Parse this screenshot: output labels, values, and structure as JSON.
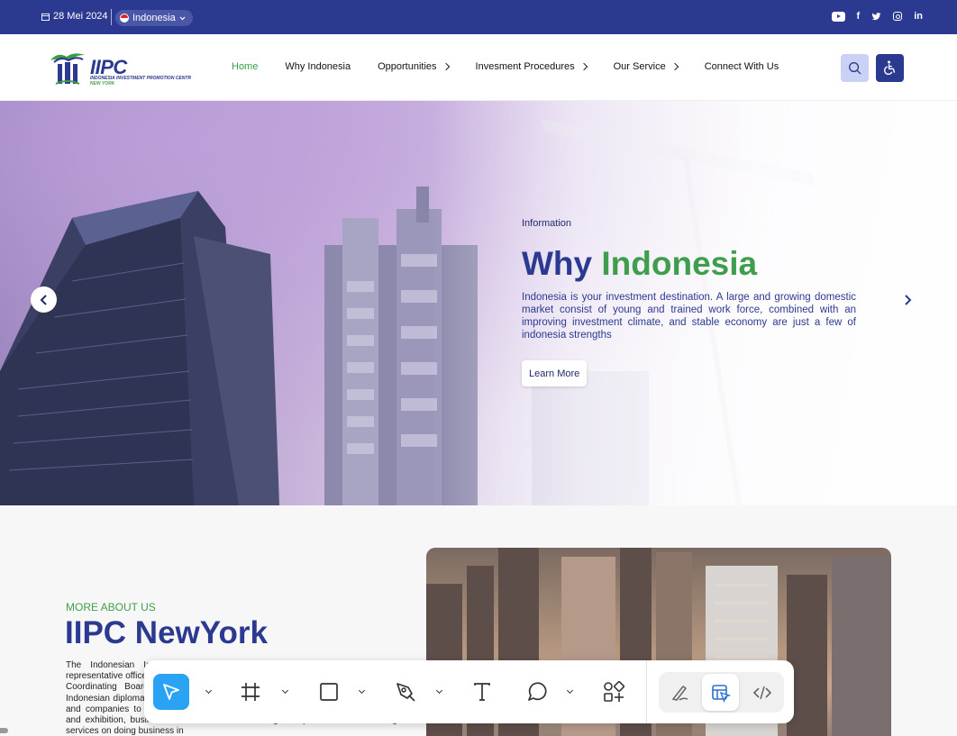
{
  "topbar": {
    "date": "28 Mei 2024",
    "language": "Indonesia",
    "socials": [
      "youtube-icon",
      "facebook-icon",
      "twitter-icon",
      "instagram-icon",
      "linkedin-icon"
    ]
  },
  "logo": {
    "text": "IIPC",
    "subtitle": "INDONESIA INVESTMENT PROMOTION CENTR",
    "location": "NEW YORK"
  },
  "nav": {
    "items": [
      {
        "label": "Home",
        "active": true
      },
      {
        "label": "Why Indonesia"
      },
      {
        "label": "Opportunities"
      },
      {
        "label": "Invesment Procedures"
      },
      {
        "label": "Our Service"
      },
      {
        "label": "Connect With Us"
      }
    ]
  },
  "hero": {
    "label": "Information",
    "title_main": "Why",
    "title_accent": "Indonesia",
    "description": "Indonesia is your investment destination. A large and growing domestic market consist of young and trained work force, combined with an improving investment climate, and stable economy are just a few of indonesia strengths",
    "button": "Learn More"
  },
  "about": {
    "subtitle": "MORE ABOUT US",
    "title": "IIPC NewYork",
    "text": "The Indonesian Investment Promotion Centre (IIPC) New York is the representative office of the Indonesia Ministry of Investment / Indonesia Investment Coordinating Board (BKPM). IIPC New York cooperates closely with the Indonesian diplomatic missions in the USA, as well as with business associations and companies to promote Indonesia's investment through investment seminar and exhibition, business mission and matchmaking. We provide free consulting services on doing business in",
    "image_logo": "IIPC"
  },
  "toolbar": {
    "tools": [
      "select-tool",
      "frame-tool",
      "rectangle-tool",
      "pen-tool",
      "text-tool",
      "comment-tool",
      "assets-tool"
    ],
    "modes": [
      "draw-mode",
      "design-mode",
      "dev-mode"
    ],
    "accent": "#2aa3f5"
  },
  "colors": {
    "brand": "#2b3990",
    "accent": "#3f9e4d"
  }
}
